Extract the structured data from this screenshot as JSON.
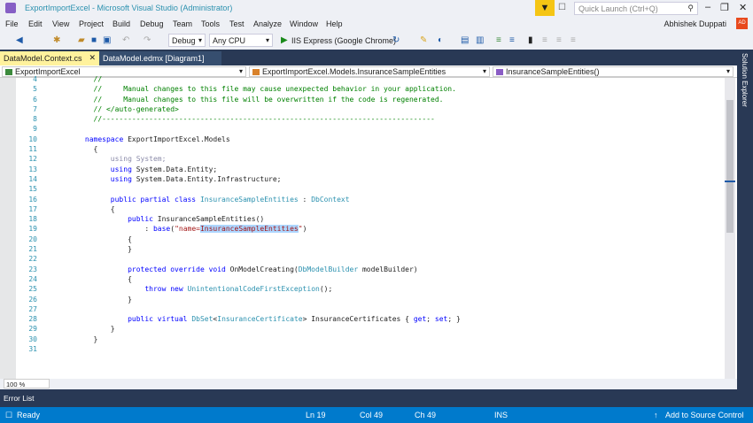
{
  "window": {
    "title": "ExportImportExcel - Microsoft Visual Studio  (Administrator)",
    "quick_launch_placeholder": "Quick Launch (Ctrl+Q)",
    "user": "Abhishek Duppati",
    "avatar": "AD"
  },
  "menu": [
    "File",
    "Edit",
    "View",
    "Project",
    "Build",
    "Debug",
    "Team",
    "Tools",
    "Test",
    "Analyze",
    "Window",
    "Help"
  ],
  "toolbar": {
    "config": "Debug",
    "platform": "Any CPU",
    "run": "IIS Express (Google Chrome)"
  },
  "tabs": [
    {
      "label": "DataModel.Context.cs",
      "active": true
    },
    {
      "label": "DataModel.edmx [Diagram1]",
      "active": false
    }
  ],
  "navbar": {
    "project": "ExportImportExcel",
    "type": "ExportImportExcel.Models.InsuranceSampleEntities",
    "member": "InsuranceSampleEntities()"
  },
  "code": [
    {
      "n": "4",
      "tokens": [
        [
          "        //",
          "c"
        ]
      ]
    },
    {
      "n": "5",
      "tokens": [
        [
          "        //     Manual changes to this file may cause unexpected behavior in your application.",
          "c"
        ]
      ]
    },
    {
      "n": "6",
      "tokens": [
        [
          "        //     Manual changes to this file will be overwritten if the code is regenerated.",
          "c"
        ]
      ]
    },
    {
      "n": "7",
      "tokens": [
        [
          "        // </auto-generated>",
          "c"
        ]
      ]
    },
    {
      "n": "8",
      "tokens": [
        [
          "        //------------------------------------------------------------------------------",
          "c"
        ]
      ]
    },
    {
      "n": "9",
      "tokens": []
    },
    {
      "n": "10",
      "tokens": [
        [
          "      ",
          ""
        ],
        [
          "namespace",
          "k"
        ],
        [
          " ExportImportExcel.Models",
          ""
        ]
      ]
    },
    {
      "n": "11",
      "tokens": [
        [
          "        {",
          ""
        ]
      ]
    },
    {
      "n": "12",
      "tokens": [
        [
          "            ",
          ""
        ],
        [
          "using System;",
          "g"
        ]
      ]
    },
    {
      "n": "13",
      "tokens": [
        [
          "            ",
          ""
        ],
        [
          "using",
          "k"
        ],
        [
          " System.Data.Entity;",
          ""
        ]
      ]
    },
    {
      "n": "14",
      "tokens": [
        [
          "            ",
          ""
        ],
        [
          "using",
          "k"
        ],
        [
          " System.Data.Entity.Infrastructure;",
          ""
        ]
      ]
    },
    {
      "n": "15",
      "tokens": []
    },
    {
      "n": "16",
      "tokens": [
        [
          "            ",
          ""
        ],
        [
          "public partial class",
          "k"
        ],
        [
          " ",
          ""
        ],
        [
          "InsuranceSampleEntities",
          "t"
        ],
        [
          " : ",
          ""
        ],
        [
          "DbContext",
          "t"
        ]
      ]
    },
    {
      "n": "17",
      "tokens": [
        [
          "            {",
          ""
        ]
      ]
    },
    {
      "n": "18",
      "tokens": [
        [
          "                ",
          ""
        ],
        [
          "public",
          "k"
        ],
        [
          " InsuranceSampleEntities()",
          ""
        ]
      ]
    },
    {
      "n": "19",
      "tokens": [
        [
          "                    : ",
          ""
        ],
        [
          "base",
          "k"
        ],
        [
          "(",
          ""
        ],
        [
          "\"name=",
          "s"
        ],
        [
          "InsuranceSampleEntities",
          "s h"
        ],
        [
          "\"",
          "s"
        ],
        [
          ")",
          ""
        ]
      ]
    },
    {
      "n": "20",
      "tokens": [
        [
          "                {",
          ""
        ]
      ]
    },
    {
      "n": "21",
      "tokens": [
        [
          "                }",
          ""
        ]
      ]
    },
    {
      "n": "22",
      "tokens": []
    },
    {
      "n": "23",
      "tokens": [
        [
          "                ",
          ""
        ],
        [
          "protected override void",
          "k"
        ],
        [
          " OnModelCreating(",
          ""
        ],
        [
          "DbModelBuilder",
          "t"
        ],
        [
          " modelBuilder)",
          ""
        ]
      ]
    },
    {
      "n": "24",
      "tokens": [
        [
          "                {",
          ""
        ]
      ]
    },
    {
      "n": "25",
      "tokens": [
        [
          "                    ",
          ""
        ],
        [
          "throw new",
          "k"
        ],
        [
          " ",
          ""
        ],
        [
          "UnintentionalCodeFirstException",
          "t"
        ],
        [
          "();",
          ""
        ]
      ]
    },
    {
      "n": "26",
      "tokens": [
        [
          "                }",
          ""
        ]
      ]
    },
    {
      "n": "27",
      "tokens": []
    },
    {
      "n": "28",
      "tokens": [
        [
          "                ",
          ""
        ],
        [
          "public virtual",
          "k"
        ],
        [
          " ",
          ""
        ],
        [
          "DbSet",
          "t"
        ],
        [
          "<",
          ""
        ],
        [
          "InsuranceCertificate",
          "t"
        ],
        [
          "> InsuranceCertificates { ",
          ""
        ],
        [
          "get",
          "k"
        ],
        [
          "; ",
          ""
        ],
        [
          "set",
          "k"
        ],
        [
          "; }",
          ""
        ]
      ]
    },
    {
      "n": "29",
      "tokens": [
        [
          "            }",
          ""
        ]
      ]
    },
    {
      "n": "30",
      "tokens": [
        [
          "        }",
          ""
        ]
      ]
    },
    {
      "n": "31",
      "tokens": []
    }
  ],
  "editor": {
    "zoom": "100 %"
  },
  "panels": {
    "error_list": "Error List",
    "solution_explorer": "Solution Explorer"
  },
  "status": {
    "ready": "Ready",
    "ln": "Ln 19",
    "col": "Col 49",
    "ch": "Ch 49",
    "mode": "INS",
    "source_control": "Add to Source Control"
  }
}
